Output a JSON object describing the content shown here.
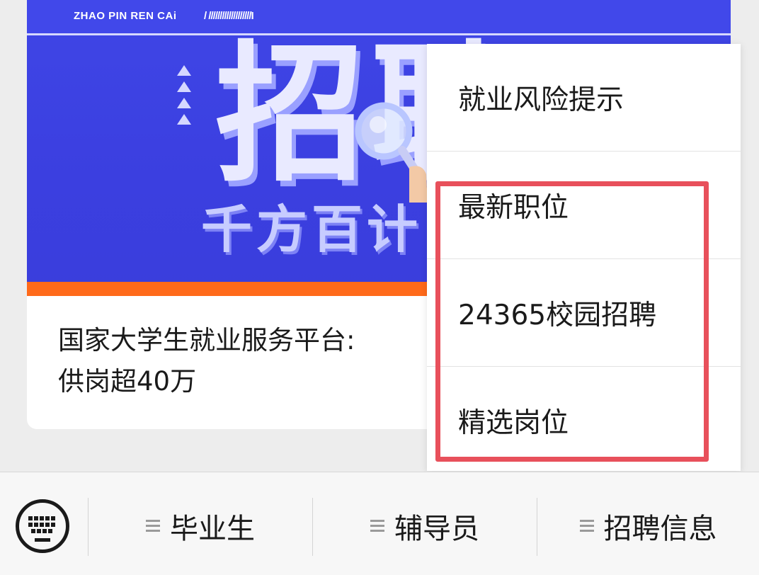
{
  "article": {
    "banner_brand": "ZHAO PIN REN CAi",
    "banner_slashes": "/ ///////////////////I",
    "banner_big_text": "招聘",
    "banner_sub_text": "千方百计",
    "title_line1": "国家大学生就业服务平台:",
    "title_line2": "供岗超40万"
  },
  "popup_menu": {
    "items": [
      {
        "label": "就业风险提示"
      },
      {
        "label": "最新职位"
      },
      {
        "label": "24365校园招聘"
      },
      {
        "label": "精选岗位"
      }
    ],
    "highlight_color": "#e8505b"
  },
  "bottom_bar": {
    "keyboard_icon": "keyboard-icon",
    "tabs": [
      {
        "label": "毕业生",
        "icon": "menu-icon"
      },
      {
        "label": "辅导员",
        "icon": "menu-icon"
      },
      {
        "label": "招聘信息",
        "icon": "menu-icon"
      }
    ]
  },
  "colors": {
    "banner_blue": "#3f46e6",
    "banner_stripe": "#ff6a1a",
    "highlight_red": "#e8505b"
  }
}
